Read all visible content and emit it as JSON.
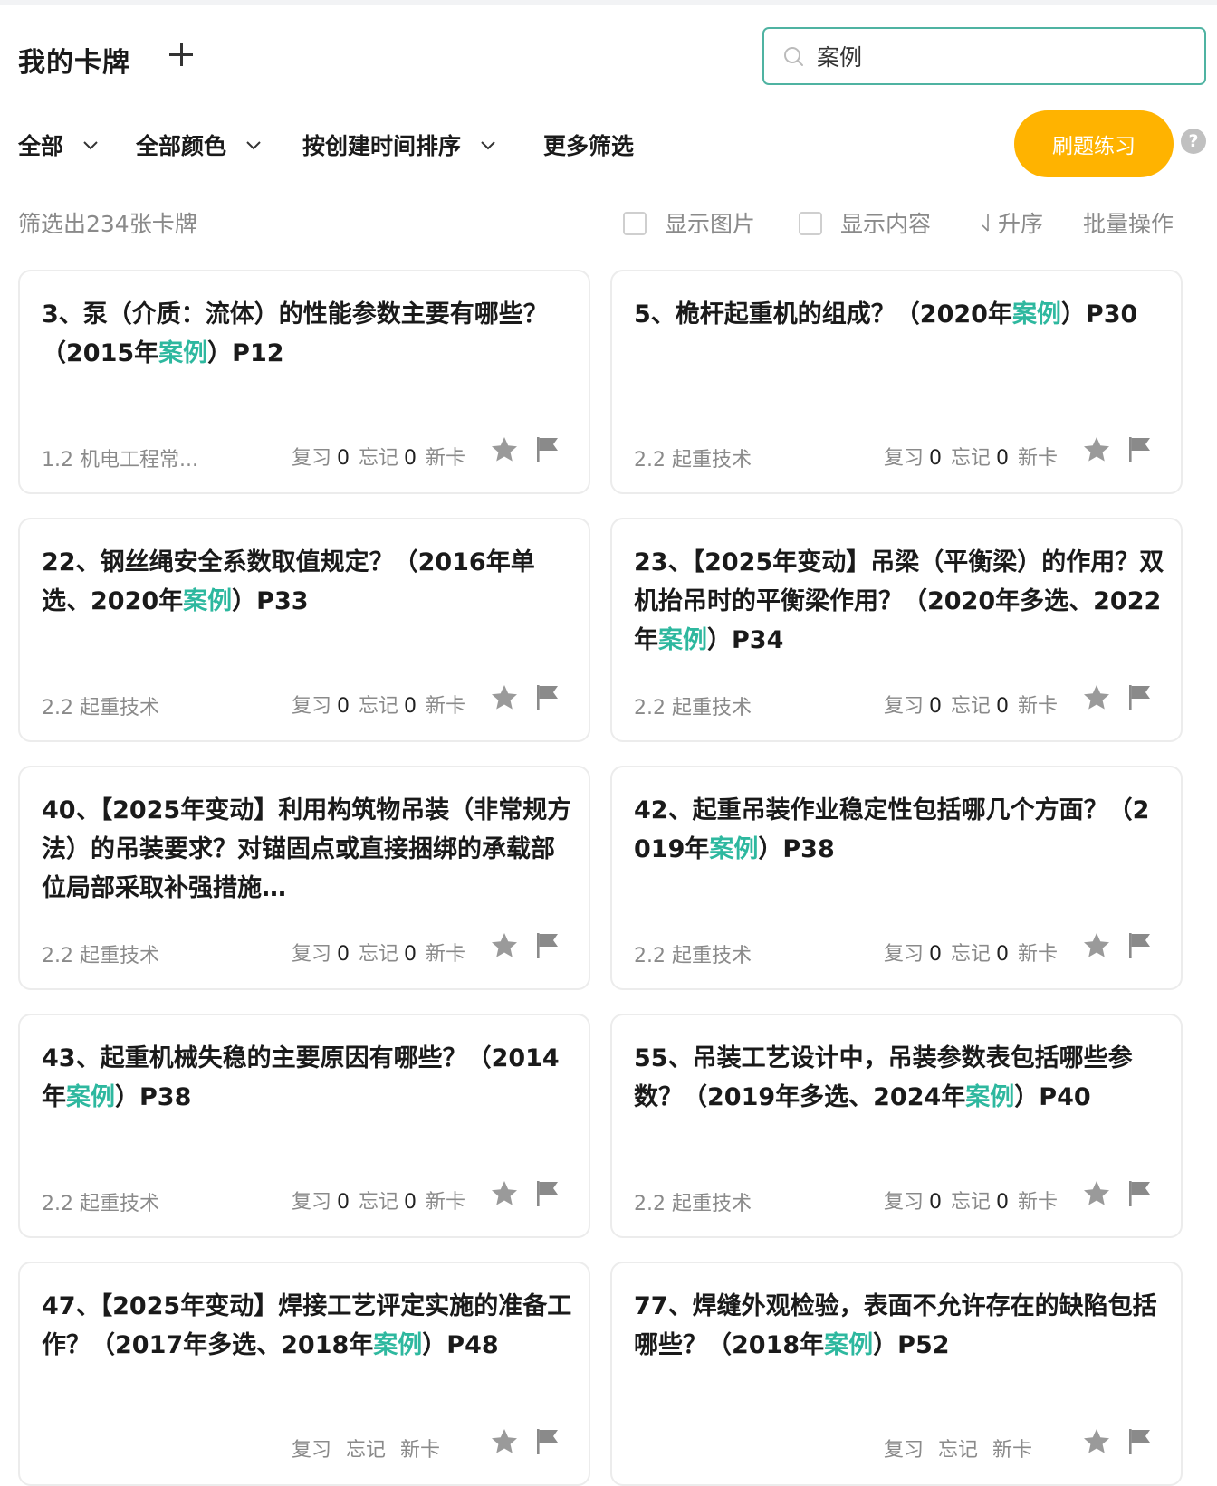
{
  "header": {
    "title": "我的卡牌",
    "add_icon": "plus-icon",
    "search": {
      "value": "案例",
      "icon": "search-icon"
    }
  },
  "filters": {
    "all": "全部",
    "color": "全部颜色",
    "sort": "按创建时间排序",
    "more": "更多筛选",
    "practice": "刷题练习",
    "help": "?"
  },
  "status": {
    "count": "筛选出234张卡牌",
    "show_image": "显示图片",
    "show_content": "显示内容",
    "ascending": "升序",
    "batch": "批量操作"
  },
  "labels": {
    "review": "复习",
    "forget": "忘记",
    "new": "新卡"
  },
  "colors": {
    "accent": "#2eb89f",
    "primary_button": "#ffb300",
    "search_border": "#4fb3a2"
  },
  "cards": [
    {
      "pre": "3、泵（介质：流体）的性能参数主要有哪些？（2015年",
      "hl": "案例",
      "post": "）P12",
      "category": "1.2 机电工程常...",
      "review": "0",
      "forget": "0"
    },
    {
      "pre": "5、桅杆起重机的组成？（2020年",
      "hl": "案例",
      "post": "）P30",
      "category": "2.2 起重技术",
      "review": "0",
      "forget": "0"
    },
    {
      "pre": "22、钢丝绳安全系数取值规定？（2016年单选、2020年",
      "hl": "案例",
      "post": "）P33",
      "category": "2.2 起重技术",
      "review": "0",
      "forget": "0"
    },
    {
      "pre": "23、【2025年变动】吊梁（平衡梁）的作用？双机抬吊时的平衡梁作用？（2020年多选、2022年",
      "hl": "案例",
      "post": "）P34",
      "category": "2.2 起重技术",
      "review": "0",
      "forget": "0"
    },
    {
      "pre": "40、【2025年变动】利用构筑物吊装（非常规方法）的吊装要求？对锚固点或直接捆绑的承载部位局部采取补强措施…",
      "hl": "",
      "post": "",
      "category": "2.2 起重技术",
      "review": "0",
      "forget": "0"
    },
    {
      "pre": "42、起重吊装作业稳定性包括哪几个方面？（2019年",
      "hl": "案例",
      "post": "）P38",
      "category": "2.2 起重技术",
      "review": "0",
      "forget": "0"
    },
    {
      "pre": "43、起重机械失稳的主要原因有哪些？（2014年",
      "hl": "案例",
      "post": "）P38",
      "category": "2.2 起重技术",
      "review": "0",
      "forget": "0"
    },
    {
      "pre": "55、吊装工艺设计中，吊装参数表包括哪些参数？（2019年多选、2024年",
      "hl": "案例",
      "post": "）P40",
      "category": "2.2 起重技术",
      "review": "0",
      "forget": "0"
    },
    {
      "pre": "47、【2025年变动】焊接工艺评定实施的准备工作？（2017年多选、2018年",
      "hl": "案例",
      "post": "）P48",
      "category": "",
      "review": "",
      "forget": ""
    },
    {
      "pre": "77、焊缝外观检验，表面不允许存在的缺陷包括哪些？（2018年",
      "hl": "案例",
      "post": "）P52",
      "category": "",
      "review": "",
      "forget": ""
    }
  ]
}
